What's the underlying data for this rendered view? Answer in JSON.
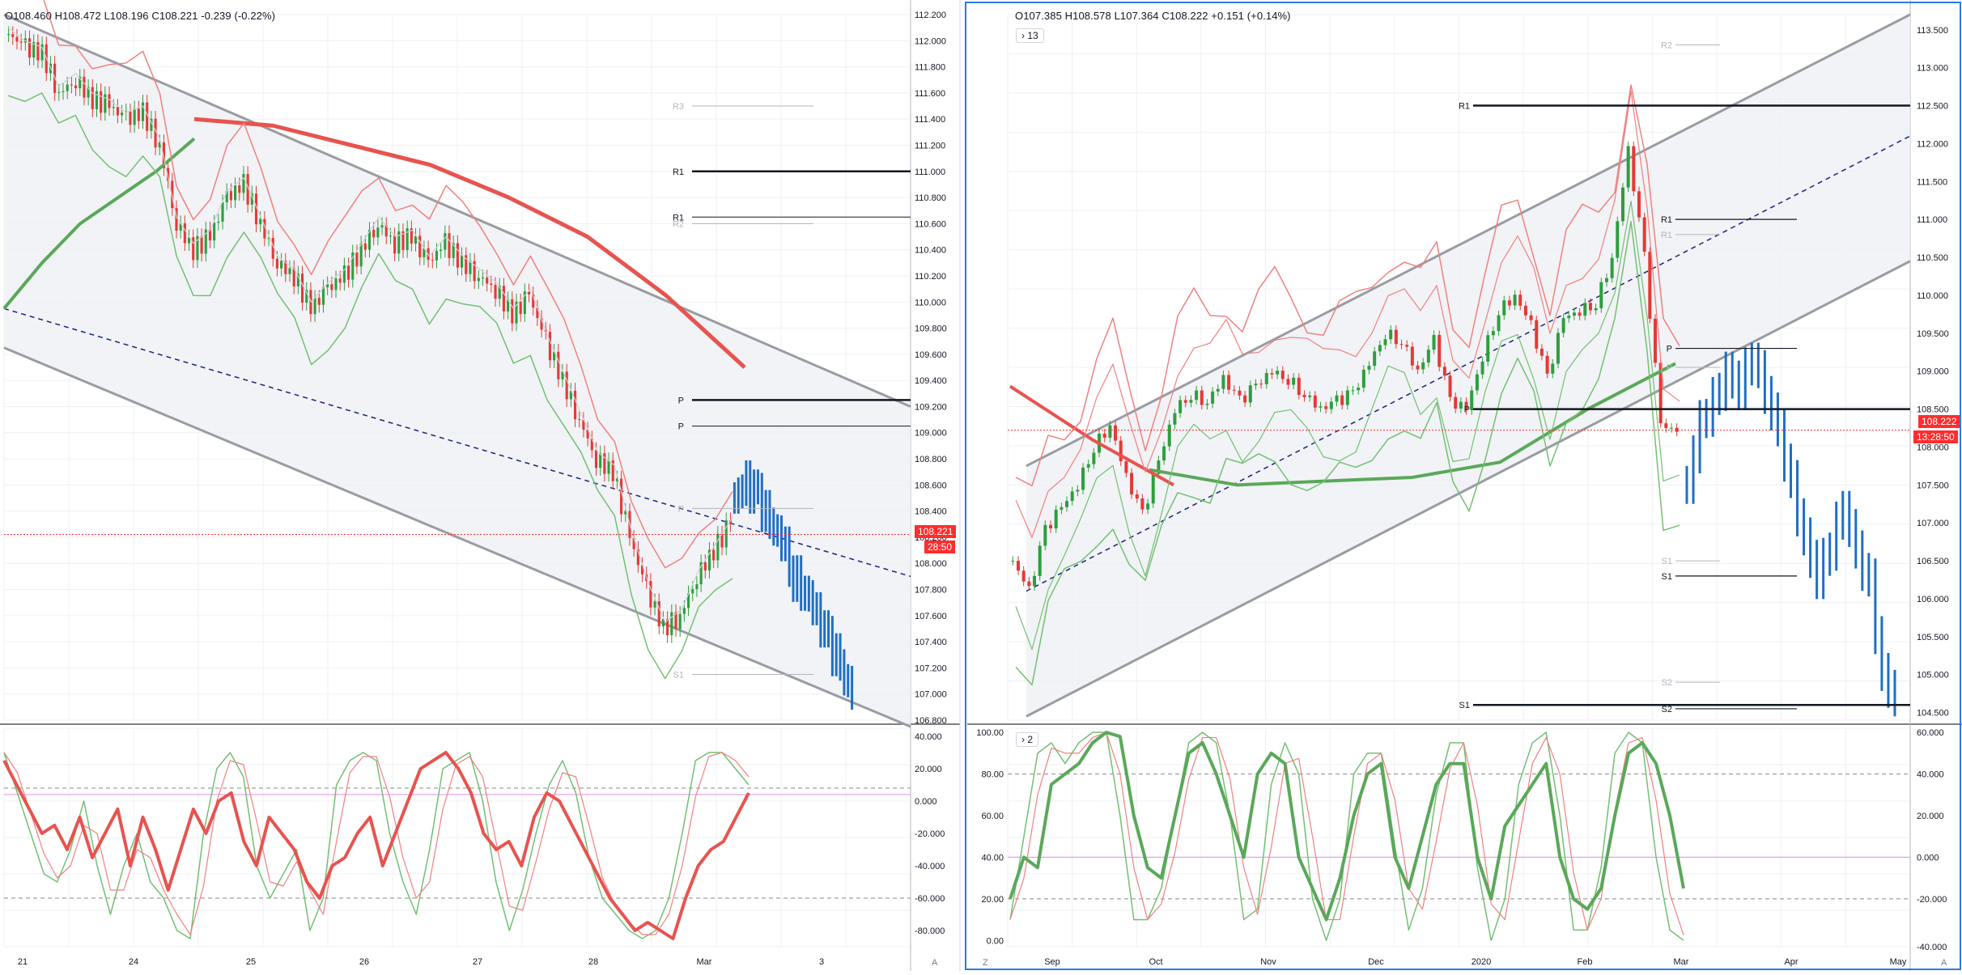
{
  "left_panel": {
    "ohlc": {
      "o": "108.460",
      "h": "108.472",
      "l": "108.196",
      "c": "108.221",
      "chg": "-0.239",
      "pct": "(-0.22%)"
    },
    "last_price_label": "108.221",
    "countdown_label": "28:50",
    "corner_label": "A"
  },
  "right_panel": {
    "ohlc": {
      "o": "107.385",
      "h": "108.578",
      "l": "107.364",
      "c": "108.222",
      "chg": "+0.151",
      "pct": "(+0.14%)"
    },
    "indicators_toggle": "13",
    "oscillator_toggle": "2",
    "last_price_label": "108.222",
    "countdown_label": "13:28:50",
    "corner_label_left": "Z",
    "corner_label_right": "A"
  },
  "colors": {
    "up_candle": "#2e9e3e",
    "down_candle": "#e53935",
    "projection": "#1e6fc4",
    "channel_fill": "#eef0f4",
    "channel_line": "#9a9ca3",
    "midline": "#1a237e",
    "ma_green": "#5aa85a",
    "ma_red": "#e8534f",
    "env_red": "#f08080",
    "env_green": "#74bf74",
    "accent_red": "#ff2d2d",
    "panel_border": "#2a7be4"
  },
  "chart_data": [
    {
      "type": "candlestick",
      "title": "",
      "timeframe_hint": "intraday",
      "x_tick_labels": [
        "21",
        "24",
        "25",
        "26",
        "27",
        "28",
        "Mar",
        "3"
      ],
      "ylim": [
        106.8,
        112.2
      ],
      "y_tick_labels": [
        "106.800",
        "107.000",
        "107.200",
        "107.400",
        "107.600",
        "107.800",
        "108.000",
        "108.200",
        "108.400",
        "108.600",
        "108.800",
        "109.000",
        "109.200",
        "109.400",
        "109.600",
        "109.800",
        "110.000",
        "110.200",
        "110.400",
        "110.600",
        "110.800",
        "111.000",
        "111.200",
        "111.400",
        "111.600",
        "111.800",
        "112.000",
        "112.200"
      ],
      "last_price": 108.221,
      "close_path_by_day": [
        {
          "day": "21",
          "closes": [
            112.05,
            111.95,
            111.9,
            111.6,
            111.7,
            111.55
          ]
        },
        {
          "day": "24",
          "closes": [
            111.5,
            111.4,
            111.45,
            111.2,
            110.6,
            110.4,
            110.5
          ]
        },
        {
          "day": "25",
          "closes": [
            110.8,
            110.9,
            110.6,
            110.3,
            110.2,
            109.95,
            110.1
          ]
        },
        {
          "day": "26",
          "closes": [
            110.2,
            110.4,
            110.6,
            110.45,
            110.5,
            110.3,
            110.45
          ]
        },
        {
          "day": "27",
          "closes": [
            110.3,
            110.2,
            110.1,
            109.9,
            110.05,
            109.7,
            109.4
          ]
        },
        {
          "day": "28",
          "closes": [
            109.1,
            108.8,
            108.7,
            108.2,
            107.8,
            107.5,
            107.6
          ]
        },
        {
          "day": "Mar",
          "closes": [
            107.9,
            108.1,
            108.3
          ]
        }
      ],
      "projection_closes": [
        108.5,
        108.6,
        108.5,
        108.3,
        108.2,
        107.9,
        107.8,
        107.6,
        107.4,
        107.2,
        107.0
      ],
      "pivot_levels": [
        {
          "label": "R3",
          "value": 111.5,
          "style": "faint"
        },
        {
          "label": "R1",
          "value": 111.0,
          "style": "bold"
        },
        {
          "label": "R1",
          "value": 110.65,
          "style": "thin"
        },
        {
          "label": "R2",
          "value": 110.6,
          "style": "faint"
        },
        {
          "label": "P",
          "value": 109.25,
          "style": "bold"
        },
        {
          "label": "P",
          "value": 109.05,
          "style": "thin"
        },
        {
          "label": "P",
          "value": 108.42,
          "style": "faint"
        },
        {
          "label": "S1",
          "value": 107.15,
          "style": "faint"
        }
      ],
      "channel": {
        "upper": [
          112.2,
          109.2
        ],
        "mid": [
          109.95,
          107.9
        ],
        "lower": [
          109.65,
          106.75
        ]
      },
      "moving_averages": {
        "green_ma": [
          109.95,
          110.3,
          110.6,
          110.8,
          111.0,
          111.25
        ],
        "red_ma": [
          111.4,
          111.35,
          111.2,
          111.05,
          110.8,
          110.5,
          110.05,
          109.5
        ]
      }
    },
    {
      "type": "line",
      "title": "",
      "ylim": [
        -90,
        45
      ],
      "y_tick_labels": [
        "-80.000",
        "-60.000",
        "-40.000",
        "-20.000",
        "0.000",
        "20.000",
        "40.000"
      ],
      "reference_lines": [
        8,
        4,
        -60
      ],
      "series": [
        {
          "values": [
            25,
            10,
            -5,
            -20,
            -15,
            -30,
            -10,
            -35,
            -20,
            -5,
            -40,
            -10,
            -30,
            -55,
            -30,
            -5,
            -20,
            0,
            5,
            -25,
            -40,
            -10,
            -20,
            -30,
            -50,
            -60,
            -40,
            -35,
            -20,
            -10,
            -40,
            -20,
            0,
            20,
            25,
            30,
            20,
            5,
            -20,
            -30,
            -25,
            -40,
            -10,
            5,
            0,
            -15,
            -30,
            -45,
            -60,
            -70,
            -80,
            -75,
            -80,
            -85,
            -60,
            -40,
            -30,
            -25,
            -10,
            5
          ]
        },
        {
          "values": [
            30,
            5,
            -20,
            -45,
            -50,
            -30,
            0,
            -40,
            -70,
            -40,
            -20,
            -50,
            -60,
            -80,
            -85,
            -20,
            20,
            30,
            15,
            -40,
            -60,
            -45,
            -30,
            -80,
            -60,
            10,
            25,
            30,
            25,
            -20,
            -50,
            -70,
            -30,
            20,
            25,
            30,
            0,
            -50,
            -80,
            -55,
            -20,
            10,
            25,
            5,
            -35,
            -60,
            -70,
            -80,
            -85,
            -80,
            -60,
            -20,
            25,
            30,
            30,
            20,
            10
          ]
        }
      ]
    },
    {
      "type": "candlestick",
      "title": "",
      "timeframe_hint": "daily",
      "x_tick_labels": [
        "Sep",
        "Oct",
        "Nov",
        "Dec",
        "2020",
        "Feb",
        "Mar",
        "Apr",
        "May"
      ],
      "ylim": [
        104.4,
        113.7
      ],
      "y_tick_labels": [
        "104.500",
        "105.000",
        "105.500",
        "106.000",
        "106.500",
        "107.000",
        "107.500",
        "108.000",
        "108.500",
        "109.000",
        "109.500",
        "110.000",
        "110.500",
        "111.000",
        "111.500",
        "112.000",
        "112.500",
        "113.000",
        "113.500"
      ],
      "last_price": 108.222,
      "monthly_closes": [
        {
          "month": "Sep",
          "closes": [
            106.5,
            106.1,
            106.9,
            107.2,
            107.5,
            108.0,
            108.3
          ]
        },
        {
          "month": "Oct",
          "closes": [
            107.6,
            107.1,
            107.8,
            108.5,
            108.7,
            108.6,
            108.9
          ]
        },
        {
          "month": "Nov",
          "closes": [
            108.6,
            108.8,
            109.0,
            108.9,
            108.7,
            108.5,
            108.6
          ]
        },
        {
          "month": "Dec",
          "closes": [
            108.7,
            109.1,
            109.5,
            109.4,
            109.0,
            109.4,
            108.6
          ]
        },
        {
          "month": "2020",
          "closes": [
            108.5,
            109.2,
            109.8,
            110.0,
            109.6,
            108.9,
            109.7
          ]
        },
        {
          "month": "Feb",
          "closes": [
            109.8,
            109.9,
            110.5,
            111.9,
            110.5,
            108.3,
            108.2
          ]
        }
      ],
      "projection_closes": [
        107.5,
        108.3,
        108.6,
        109.0,
        108.8,
        109.2,
        108.7,
        108.2,
        107.5,
        106.8,
        106.3,
        106.7,
        107.2,
        106.6,
        106.2,
        105.0,
        104.7
      ],
      "pivot_levels": [
        {
          "label": "R2",
          "value": 113.3,
          "style": "faint"
        },
        {
          "label": "R1",
          "value": 112.5,
          "style": "bold"
        },
        {
          "label": "R1",
          "value": 111.0,
          "style": "thin"
        },
        {
          "label": "R1",
          "value": 110.8,
          "style": "faint"
        },
        {
          "label": "P",
          "value": 109.3,
          "style": "thin"
        },
        {
          "label": "P",
          "value": 109.05,
          "style": "faint"
        },
        {
          "label": "P",
          "value": 108.5,
          "style": "bold"
        },
        {
          "label": "S1",
          "value": 106.5,
          "style": "faint"
        },
        {
          "label": "S1",
          "value": 106.3,
          "style": "thin"
        },
        {
          "label": "S2",
          "value": 104.9,
          "style": "faint"
        },
        {
          "label": "S1",
          "value": 104.6,
          "style": "bold"
        },
        {
          "label": "S2",
          "value": 104.55,
          "style": "thin"
        }
      ],
      "channel": {
        "upper": [
          107.75,
          113.7
        ],
        "mid": [
          106.1,
          112.1
        ],
        "lower": [
          104.45,
          110.45
        ]
      },
      "moving_averages": {
        "green_ma": [
          107.7,
          107.5,
          107.55,
          107.6,
          107.8,
          108.5,
          109.1
        ],
        "red_ma": [
          108.8,
          108.1,
          107.5
        ]
      }
    },
    {
      "type": "line",
      "title": "",
      "ylim": [
        -3,
        102
      ],
      "y_tick_labels_left": [
        "0.00",
        "20.00",
        "40.00",
        "60.00",
        "80.00",
        "100.00"
      ],
      "y_tick_labels_right": [
        "-40.000",
        "-20.000",
        "0.000",
        "20.000",
        "40.000",
        "60.000"
      ],
      "reference_lines": [
        80,
        40,
        20
      ],
      "series": [
        {
          "values": [
            20,
            40,
            35,
            75,
            80,
            85,
            95,
            100,
            98,
            60,
            35,
            30,
            60,
            90,
            95,
            80,
            60,
            40,
            80,
            90,
            85,
            40,
            25,
            10,
            30,
            60,
            80,
            85,
            40,
            25,
            50,
            75,
            85,
            85,
            40,
            20,
            55,
            65,
            75,
            85,
            40,
            20,
            15,
            25,
            60,
            90,
            95,
            85,
            60,
            25
          ]
        },
        {
          "values": [
            10,
            50,
            90,
            95,
            85,
            95,
            100,
            100,
            60,
            10,
            10,
            25,
            60,
            95,
            100,
            95,
            60,
            10,
            15,
            75,
            95,
            80,
            20,
            0,
            20,
            80,
            90,
            90,
            45,
            5,
            25,
            70,
            95,
            95,
            35,
            0,
            20,
            75,
            95,
            100,
            60,
            5,
            5,
            35,
            90,
            100,
            95,
            40,
            5,
            0
          ]
        }
      ]
    }
  ]
}
